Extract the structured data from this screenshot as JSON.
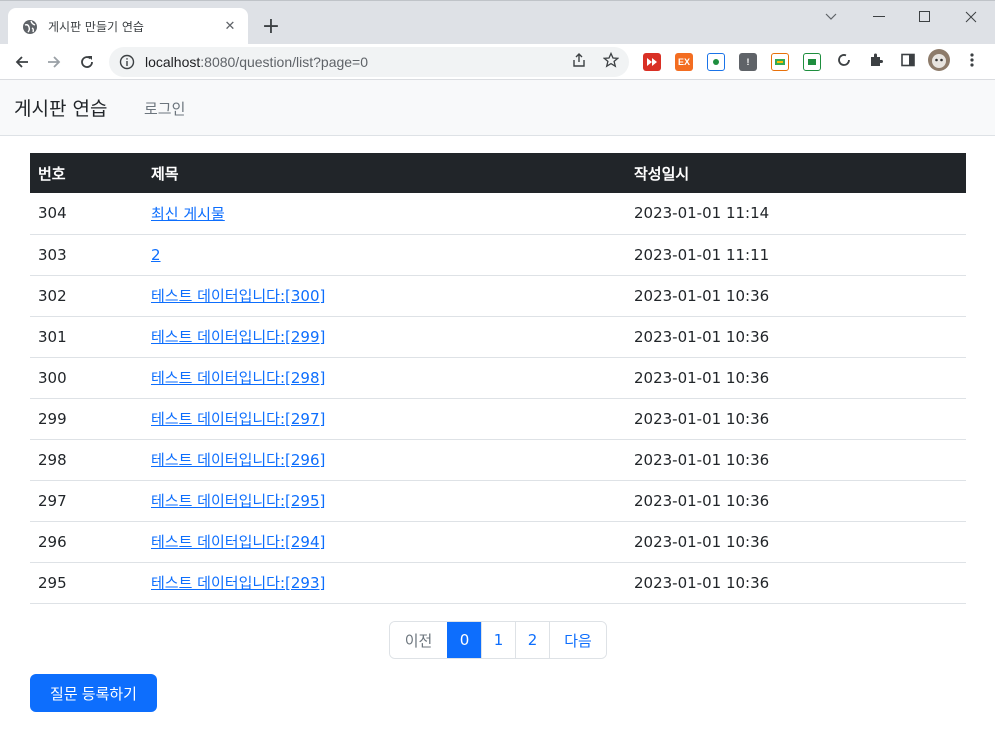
{
  "browser": {
    "tab_title": "게시판 만들기 연습",
    "url_host": "localhost",
    "url_rest": ":8080/question/list?page=0",
    "icons": [
      "globe-icon",
      "close-icon",
      "plus-icon",
      "chevron-down-icon",
      "minimize-icon",
      "maximize-icon",
      "window-close-icon",
      "back-icon",
      "forward-icon",
      "reload-icon",
      "info-icon",
      "share-icon",
      "star-icon",
      "extensions-icon",
      "sidepanel-icon",
      "profile-avatar",
      "menu-icon"
    ],
    "extensions": [
      {
        "name": "ext-red-icon",
        "label": "",
        "color": "#d93025"
      },
      {
        "name": "ext-orange-icon",
        "label": "EX",
        "color": "#f36d21"
      },
      {
        "name": "ext-blue-icon",
        "label": "",
        "color": "#1a73e8"
      },
      {
        "name": "ext-dark-icon",
        "label": "!",
        "color": "#5f6368"
      },
      {
        "name": "ext-multi-icon",
        "label": "",
        "color": "#e8710a"
      },
      {
        "name": "ext-green-icon",
        "label": "",
        "color": "#1e8e3e"
      }
    ]
  },
  "navbar": {
    "brand": "게시판 연습",
    "login": "로그인"
  },
  "table": {
    "headers": [
      "번호",
      "제목",
      "작성일시"
    ],
    "rows": [
      {
        "num": "304",
        "subject": "최신 게시물",
        "date": "2023-01-01 11:14"
      },
      {
        "num": "303",
        "subject": "2",
        "date": "2023-01-01 11:11"
      },
      {
        "num": "302",
        "subject": "테스트 데이터입니다:[300]",
        "date": "2023-01-01 10:36"
      },
      {
        "num": "301",
        "subject": "테스트 데이터입니다:[299]",
        "date": "2023-01-01 10:36"
      },
      {
        "num": "300",
        "subject": "테스트 데이터입니다:[298]",
        "date": "2023-01-01 10:36"
      },
      {
        "num": "299",
        "subject": "테스트 데이터입니다:[297]",
        "date": "2023-01-01 10:36"
      },
      {
        "num": "298",
        "subject": "테스트 데이터입니다:[296]",
        "date": "2023-01-01 10:36"
      },
      {
        "num": "297",
        "subject": "테스트 데이터입니다:[295]",
        "date": "2023-01-01 10:36"
      },
      {
        "num": "296",
        "subject": "테스트 데이터입니다:[294]",
        "date": "2023-01-01 10:36"
      },
      {
        "num": "295",
        "subject": "테스트 데이터입니다:[293]",
        "date": "2023-01-01 10:36"
      }
    ]
  },
  "pagination": {
    "prev": "이전",
    "pages": [
      "0",
      "1",
      "2"
    ],
    "current": "0",
    "next": "다음"
  },
  "actions": {
    "create_question": "질문 등록하기"
  },
  "colors": {
    "primary": "#0d6efd",
    "table_header": "#212529",
    "navbar_bg": "#f8f9fa"
  }
}
